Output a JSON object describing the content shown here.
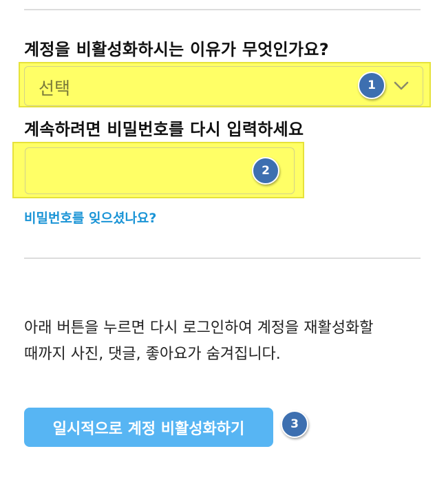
{
  "form": {
    "reason_label": "계정을 비활성화하시는 이유가 무엇인가요?",
    "reason_select_value": "선택",
    "password_label": "계속하려면 비밀번호를 다시 입력하세요",
    "password_value": "",
    "forgot_password_link": "비밀번호를 잊으셨나요?"
  },
  "info": {
    "line1": "아래 버튼을 누르면 다시 로그인하여 계정을 재활성화할",
    "line2": "때까지 사진, 댓글, 좋아요가 숨겨집니다."
  },
  "actions": {
    "deactivate_label": "일시적으로 계정 비활성화하기"
  },
  "badges": {
    "select": "1",
    "password": "2",
    "button": "3"
  },
  "colors": {
    "highlight": "#ffff66",
    "link": "#1a94d6",
    "button": "#57b5f3",
    "badge": "#3d6fb0"
  }
}
